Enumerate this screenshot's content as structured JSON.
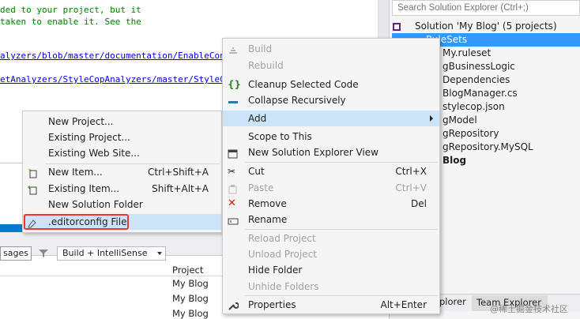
{
  "editor": {
    "lines": [
      {
        "text": "ded to your project, but it",
        "style": "green"
      },
      {
        "text": " taken to enable it. See the",
        "style": "green"
      },
      {
        "text": "alyzers/blob/master/documentation/EnableConfigur",
        "style": "link"
      },
      {
        "text": "etAnalyzers/StyleCopAnalyzers/master/StyleCop.",
        "style": "link"
      }
    ]
  },
  "solution_explorer": {
    "search_placeholder": "Search Solution Explorer (Ctrl+;)",
    "items": [
      {
        "label": "Solution 'My Blog' (5 projects)",
        "icon": "solution-icon"
      },
      {
        "label": "RuleSets",
        "icon": "folder-icon",
        "selected": true
      },
      {
        "label": "My.ruleset",
        "icon": "ruleset-icon"
      },
      {
        "label": "gBusinessLogic",
        "icon": "project-icon"
      },
      {
        "label": "Dependencies",
        "icon": "dependencies-icon"
      },
      {
        "label": "BlogManager.cs",
        "icon": "csharp-file-icon"
      },
      {
        "label": "stylecop.json",
        "icon": "json-file-icon"
      },
      {
        "label": "gModel",
        "icon": "project-icon"
      },
      {
        "label": "gRepository",
        "icon": "project-icon"
      },
      {
        "label": "gRepository.MySQL",
        "icon": "project-icon"
      },
      {
        "label": "Blog",
        "icon": "project-icon",
        "bold": true
      }
    ],
    "bottom_tab_left": "plorer",
    "bottom_tab_right": "Team Explorer",
    "watermark": "@稀土掘金技术社区"
  },
  "bottom_panel": {
    "messages_label": "sages",
    "build_select_value": "Build + IntelliSense",
    "column_project": "Project",
    "rows": [
      "My Blog",
      "My Blog",
      "My Blog"
    ]
  },
  "add_menu": {
    "items": [
      {
        "label": "New Project...",
        "shortcut": ""
      },
      {
        "label": "Existing Project...",
        "shortcut": ""
      },
      {
        "label": "Existing Web Site...",
        "shortcut": ""
      },
      {
        "label": "New Item...",
        "shortcut": "Ctrl+Shift+A",
        "icon": "new-item-icon"
      },
      {
        "label": "Existing Item...",
        "shortcut": "Shift+Alt+A",
        "icon": "existing-item-icon"
      },
      {
        "label": "New Solution Folder",
        "shortcut": ""
      },
      {
        "label": ".editorconfig File",
        "shortcut": "",
        "icon": "editorconfig-icon",
        "highlight_color": "#e53935"
      }
    ]
  },
  "context_menu": {
    "items": [
      {
        "label": "Build",
        "disabled": true,
        "icon": "build-icon"
      },
      {
        "label": "Rebuild",
        "disabled": true
      },
      {
        "label": "Cleanup Selected Code",
        "icon": "braces-icon"
      },
      {
        "label": "Collapse Recursively",
        "icon": "collapse-icon"
      },
      {
        "label": "Add",
        "submenu": true
      },
      {
        "label": "Scope to This"
      },
      {
        "label": "New Solution Explorer View",
        "icon": "new-view-icon"
      },
      {
        "label": "Cut",
        "shortcut": "Ctrl+X",
        "icon": "scissors-icon"
      },
      {
        "label": "Paste",
        "shortcut": "Ctrl+V",
        "disabled": true,
        "icon": "paste-icon"
      },
      {
        "label": "Remove",
        "shortcut": "Del",
        "icon": "remove-icon"
      },
      {
        "label": "Rename",
        "icon": "rename-icon"
      },
      {
        "label": "Reload Project",
        "disabled": true
      },
      {
        "label": "Unload Project",
        "disabled": true
      },
      {
        "label": "Hide Folder"
      },
      {
        "label": "Unhide Folders",
        "disabled": true
      },
      {
        "label": "Properties",
        "shortcut": "Alt+Enter",
        "icon": "wrench-icon"
      }
    ]
  },
  "colors": {
    "accent": "#007acc",
    "selection": "#3399ff",
    "hover": "#cce4f7",
    "highlight_box": "#e53935"
  }
}
